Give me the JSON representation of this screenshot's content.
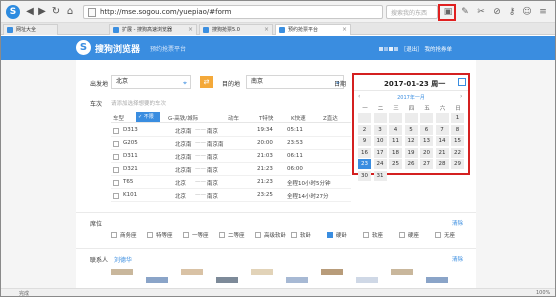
{
  "toolbar": {
    "url": "http://mse.sogou.com/yuepiao/#form",
    "search_placeholder": "搜索我的东西"
  },
  "tabs": [
    {
      "label": "网址大全"
    },
    {
      "label": "扩展 - 搜狗高速浏览器"
    },
    {
      "label": "搜狗抢票5.0"
    },
    {
      "label": "预约抢票平台"
    }
  ],
  "header": {
    "brand": "搜狗浏览器",
    "subtitle": "预约抢票平台",
    "logout": "［退出］",
    "my_orders": "我的抢券单"
  },
  "form": {
    "from_label": "出发地",
    "from_value": "北京",
    "to_label": "目的地",
    "to_value": "南京",
    "date_label": "日期",
    "train_label": "车次",
    "train_hint": "请添加选择想要的车次",
    "seat_label": "席位",
    "contact_label": "联系人",
    "contact_name": "刘德华",
    "clear": "清除"
  },
  "table": {
    "headers": [
      "车型",
      "不限",
      "G-高铁/城际",
      "动车",
      "T特快",
      "K快速",
      "Z直达"
    ],
    "rows": [
      {
        "train": "D313",
        "from": "北京南",
        "to": "南京",
        "dep": "19:34",
        "arr": "05:11"
      },
      {
        "train": "G205",
        "from": "北京南",
        "to": "南京南",
        "dep": "20:00",
        "arr": "23:53"
      },
      {
        "train": "D311",
        "from": "北京南",
        "to": "南京",
        "dep": "21:03",
        "arr": "06:11"
      },
      {
        "train": "D321",
        "from": "北京南",
        "to": "南京",
        "dep": "21:23",
        "arr": "06:00"
      },
      {
        "train": "T65",
        "from": "北京",
        "to": "南京",
        "dep": "21:23",
        "arr": "",
        "note": "全程10小时5分钟"
      },
      {
        "train": "K101",
        "from": "北京",
        "to": "南京",
        "dep": "23:25",
        "arr": "",
        "note": "全程14小时27分"
      }
    ]
  },
  "seats": [
    "商务座",
    "特等座",
    "一等座",
    "二等座",
    "高级软卧",
    "软卧",
    "硬卧",
    "软座",
    "硬座",
    "无座"
  ],
  "seat_selected": "硬卧",
  "calendar": {
    "date_text": "2017-01-23 周一",
    "month_text": "2017年一月",
    "weekdays": [
      "一",
      "二",
      "三",
      "四",
      "五",
      "六",
      "日"
    ],
    "selected_day": "23",
    "leading_blanks": 6,
    "days": [
      "1",
      "2",
      "3",
      "4",
      "5",
      "6",
      "7",
      "8",
      "9",
      "10",
      "11",
      "12",
      "13",
      "14",
      "15",
      "16",
      "17",
      "18",
      "19",
      "20",
      "21",
      "22",
      "23",
      "24",
      "25",
      "26",
      "27",
      "28",
      "29",
      "30",
      "31"
    ]
  },
  "status": {
    "left": "完成",
    "right": "100%"
  },
  "colors": {
    "brand_blue": "#3a8de0",
    "highlight_red": "#d42020",
    "swap_orange": "#f4a93a"
  }
}
